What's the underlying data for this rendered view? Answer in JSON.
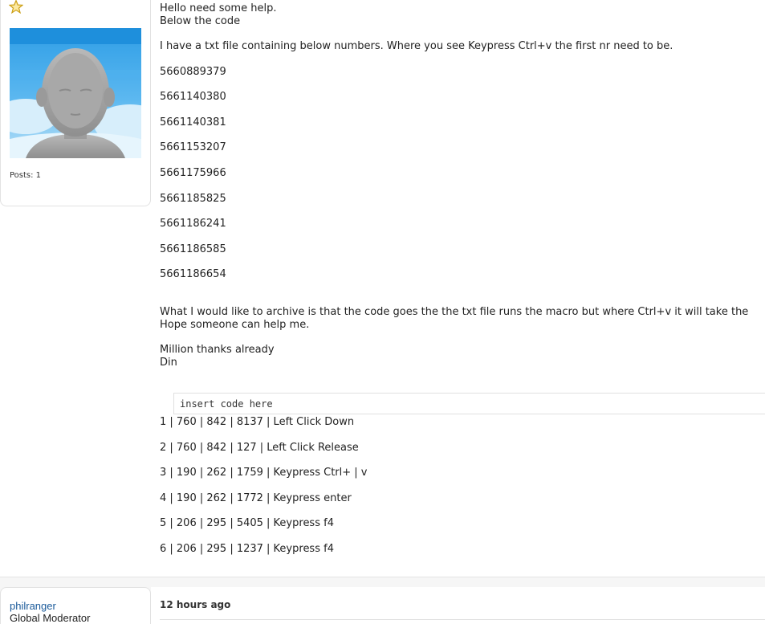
{
  "post1": {
    "user": {
      "rank_icon": "star-icon",
      "avatar": "default-avatar-icon",
      "posts_label": "Posts: 1"
    },
    "body": {
      "intro_lines": [
        "Hello need some help.",
        "Below the code"
      ],
      "description": "I have a txt file containing below numbers. Where you see Keypress Ctrl+v the first nr need to be.",
      "numbers": [
        "5660889379",
        "5661140380",
        "5661140381",
        "5661153207",
        "5661175966",
        "5661185825",
        "5661186241",
        "5661186585",
        "5661186654"
      ],
      "goal_lines": [
        "What I would like to archive is that the code goes the the txt file runs the macro but where Ctrl+v it will take the",
        "Hope someone can help me."
      ],
      "closing_lines": [
        "Million thanks already",
        "Din"
      ]
    },
    "code_box": {
      "text": "insert code here"
    },
    "macro_rows": [
      "1 | 760 | 842 | 8137 | Left Click Down",
      "2 | 760 | 842 | 127 | Left Click Release",
      "3 | 190 | 262 | 1759 | Keypress Ctrl+ | v",
      "4 | 190 | 262 | 1772 | Keypress enter",
      "5 | 206 | 295 | 5405 | Keypress f4",
      "6 | 206 | 295 | 1237 | Keypress f4"
    ]
  },
  "post2": {
    "username": "philranger",
    "role": "Global Moderator",
    "time": "12 hours ago"
  },
  "colors": {
    "link": "#1a5a9a",
    "star": "#e8b400",
    "avatar_sky": "#3aa6e8"
  }
}
